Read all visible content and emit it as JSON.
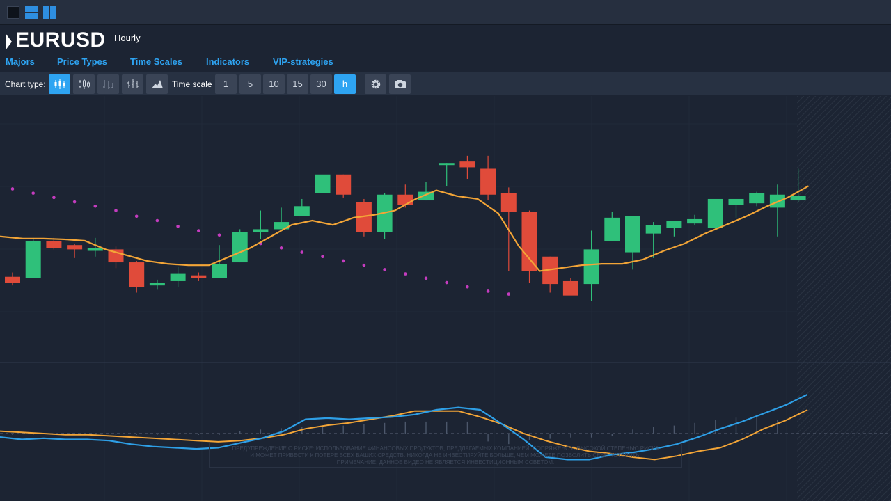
{
  "header": {
    "symbol": "EURUSD",
    "period": "Hourly",
    "nav": [
      "Majors",
      "Price  Types",
      "Time  Scales",
      "Indicators",
      "VIP-strategies"
    ]
  },
  "toolbar": {
    "chart_type_label": "Chart type:",
    "chart_types": [
      "candles-icon",
      "hollow-candles-icon",
      "bars-icon",
      "hlc-bars-icon",
      "area-icon"
    ],
    "active_chart_type": "candles-icon",
    "time_scale_label": "Time scale",
    "time_scales": [
      "1",
      "5",
      "10",
      "15",
      "30",
      "h"
    ],
    "active_time_scale": "h",
    "tools": [
      "gear-icon",
      "camera-icon"
    ]
  },
  "colors": {
    "background": "#1c2433",
    "accent": "#2ea4f2",
    "bull": "#2fc07a",
    "bear": "#e04b3a",
    "moving_average": "#f3a537",
    "parabolic_sar": "#c43cbf",
    "macd": "#2e9fe6",
    "signal": "#f3a537"
  },
  "disclaimer": {
    "line1": "ПРЕДУПРЕЖДЕНИЕ О РИСКЕ: ИСПОЛЬЗОВАНИЕ ФИНАНСОВЫХ ПРОДУКТОВ, ПРЕДЛАГАЕМЫХ КОМПАНИЕЙ, СОПРЯЖЕНО С ВЫСОКОЙ СТЕПЕНЬЮ РИСКА",
    "line2": "И МОЖЕТ ПРИВЕСТИ К ПОТЕРЕ ВСЕХ ВАШИХ СРЕДСТВ. НИКОГДА НЕ ИНВЕСТИРУЙТЕ БОЛЬШЕ, ЧЕМ МОЖЕТЕ ПОЗВОЛИТЬ СЕБЕ ПОТЕРЯТЬ.",
    "line3": "ПРИМЕЧАНИЕ: ДАННОЕ ВИДЕО НЕ ЯВЛЯЕТСЯ ИНВЕСТИЦИОННЫМ СОВЕТОМ."
  },
  "chart_data": {
    "type": "candlestick",
    "title": "",
    "price_scale": [
      0,
      100
    ],
    "candles": [
      {
        "o": 18,
        "h": 21,
        "l": 12,
        "c": 14
      },
      {
        "o": 17,
        "h": 45,
        "l": 17,
        "c": 43
      },
      {
        "o": 43,
        "h": 45,
        "l": 37,
        "c": 38
      },
      {
        "o": 40,
        "h": 41,
        "l": 31,
        "c": 37
      },
      {
        "o": 36,
        "h": 45,
        "l": 32,
        "c": 38
      },
      {
        "o": 37,
        "h": 39,
        "l": 24,
        "c": 28
      },
      {
        "o": 28,
        "h": 29,
        "l": 7,
        "c": 11
      },
      {
        "o": 12,
        "h": 16,
        "l": 9,
        "c": 14
      },
      {
        "o": 15,
        "h": 25,
        "l": 11,
        "c": 20
      },
      {
        "o": 19,
        "h": 21,
        "l": 15,
        "c": 17
      },
      {
        "o": 17,
        "h": 40,
        "l": 17,
        "c": 27
      },
      {
        "o": 28,
        "h": 51,
        "l": 28,
        "c": 49
      },
      {
        "o": 49,
        "h": 64,
        "l": 44,
        "c": 51
      },
      {
        "o": 51,
        "h": 66,
        "l": 51,
        "c": 56
      },
      {
        "o": 60,
        "h": 72,
        "l": 60,
        "c": 67
      },
      {
        "o": 76,
        "h": 87,
        "l": 76,
        "c": 89
      },
      {
        "o": 89,
        "h": 89,
        "l": 73,
        "c": 75
      },
      {
        "o": 70,
        "h": 72,
        "l": 46,
        "c": 49
      },
      {
        "o": 49,
        "h": 76,
        "l": 44,
        "c": 75
      },
      {
        "o": 75,
        "h": 82,
        "l": 66,
        "c": 68
      },
      {
        "o": 71,
        "h": 84,
        "l": 71,
        "c": 77
      },
      {
        "o": 97,
        "h": 97,
        "l": 81,
        "c": 97
      },
      {
        "o": 98,
        "h": 102,
        "l": 86,
        "c": 94
      },
      {
        "o": 93,
        "h": 102,
        "l": 71,
        "c": 75
      },
      {
        "o": 76,
        "h": 80,
        "l": 22,
        "c": 63
      },
      {
        "o": 63,
        "h": 64,
        "l": 14,
        "c": 22
      },
      {
        "o": 32,
        "h": 32,
        "l": 7,
        "c": 13
      },
      {
        "o": 15,
        "h": 17,
        "l": 6,
        "c": 5
      },
      {
        "o": 13,
        "h": 50,
        "l": 1,
        "c": 37
      },
      {
        "o": 43,
        "h": 63,
        "l": 43,
        "c": 59
      },
      {
        "o": 35,
        "h": 56,
        "l": 23,
        "c": 60
      },
      {
        "o": 48,
        "h": 56,
        "l": 31,
        "c": 54
      },
      {
        "o": 52,
        "h": 54,
        "l": 46,
        "c": 57
      },
      {
        "o": 55,
        "h": 61,
        "l": 54,
        "c": 58
      },
      {
        "o": 52,
        "h": 57,
        "l": 51,
        "c": 72
      },
      {
        "o": 68,
        "h": 72,
        "l": 59,
        "c": 72
      },
      {
        "o": 69,
        "h": 77,
        "l": 67,
        "c": 76
      },
      {
        "o": 66,
        "h": 82,
        "l": 46,
        "c": 75
      },
      {
        "o": 71,
        "h": 93,
        "l": 70,
        "c": 74
      }
    ],
    "moving_average": [
      46,
      44.5,
      44.5,
      44,
      43,
      37,
      33,
      29,
      27,
      26,
      26,
      32,
      38,
      46,
      54,
      57,
      54,
      59,
      61,
      64,
      72,
      78,
      74,
      72,
      62,
      39,
      22,
      24,
      26,
      27,
      27,
      30,
      36,
      41,
      48,
      54,
      60,
      67,
      73,
      81
    ],
    "parabolic_sar": [
      79,
      76,
      73,
      70,
      67,
      64,
      60,
      57,
      53,
      50,
      47,
      43,
      41,
      38,
      35,
      32,
      29,
      26,
      23,
      20,
      17,
      14,
      11,
      8,
      6
    ],
    "sar_highlight_index": 11,
    "oscillator": {
      "macd": [
        -3,
        -5,
        -4,
        -5,
        -5,
        -6,
        -9,
        -11,
        -12,
        -13,
        -12,
        -8,
        -4,
        2,
        12,
        13,
        12,
        13,
        14,
        16,
        20,
        22,
        20,
        8,
        -5,
        -20,
        -22,
        -22,
        -18,
        -16,
        -13,
        -9,
        -3,
        4,
        10,
        17,
        24,
        33
      ],
      "signal": [
        2,
        1,
        0,
        -1,
        -1,
        -2,
        -3,
        -4,
        -5,
        -6,
        -7,
        -6,
        -4,
        -1,
        4,
        7,
        9,
        12,
        15,
        19,
        19,
        19,
        14,
        8,
        0,
        -6,
        -11,
        -15,
        -17,
        -20,
        -22,
        -19,
        -15,
        -12,
        -5,
        4,
        11,
        20
      ],
      "histogram": [
        -1,
        -1,
        -1,
        -1,
        -1,
        -1,
        -1,
        -1,
        -1,
        -1,
        -1,
        2,
        3,
        4,
        5,
        5,
        6,
        7,
        8,
        9,
        9,
        9,
        9,
        -6,
        -8,
        -5,
        -4,
        -3,
        -3,
        -2,
        3,
        5,
        6,
        8,
        10,
        12,
        14,
        10
      ]
    }
  }
}
